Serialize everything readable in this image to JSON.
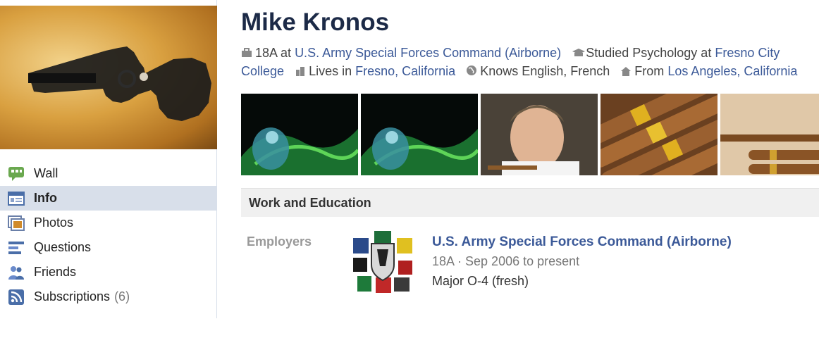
{
  "profile": {
    "name": "Mike Kronos",
    "bio": {
      "work_role": "18A at",
      "work_org": "U.S. Army Special Forces Command (Airborne)",
      "study_prefix": "Studied Psychology at",
      "study_school": "Fresno City College",
      "lives_prefix": "Lives in",
      "lives_city": "Fresno, California",
      "knows": "Knows English, French",
      "from_prefix": "From",
      "from_city": "Los Angeles, California"
    }
  },
  "sidebar": {
    "items": [
      {
        "label": "Wall",
        "icon": "wall-icon"
      },
      {
        "label": "Info",
        "icon": "info-icon",
        "active": true
      },
      {
        "label": "Photos",
        "icon": "photos-icon"
      },
      {
        "label": "Questions",
        "icon": "questions-icon"
      },
      {
        "label": "Friends",
        "icon": "friends-icon"
      },
      {
        "label": "Subscriptions",
        "icon": "subscriptions-icon",
        "count": "(6)"
      }
    ]
  },
  "work_education": {
    "title": "Work and Education",
    "employers_label": "Employers",
    "employer": {
      "name": "U.S. Army Special Forces Command (Airborne)",
      "meta": "18A · Sep 2006 to present",
      "description": "Major O-4 (fresh)"
    }
  },
  "colors": {
    "link": "#3b5998",
    "name": "#1c2a47",
    "active_nav": "#d8dfea",
    "section_bg": "#f0f0f0"
  }
}
